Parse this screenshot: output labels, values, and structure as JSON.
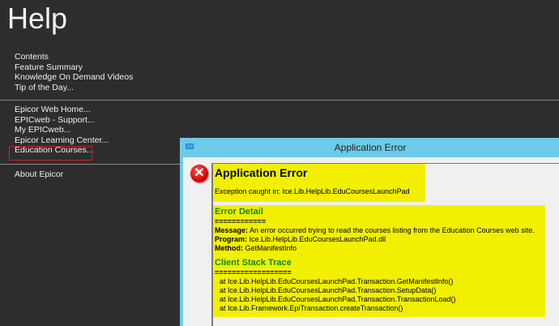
{
  "title": "Help",
  "menu_group1": [
    "Contents",
    "Feature Summary",
    "Knowledge On Demand Videos",
    "Tip of the Day..."
  ],
  "menu_group2": [
    "Epicor Web Home...",
    "EPICweb - Support...",
    "My EPICweb...",
    "Epicor Learning Center...",
    "Education Courses..."
  ],
  "menu_group3": [
    "About Epicor"
  ],
  "dialog": {
    "title": "Application Error",
    "heading": "Application Error",
    "exception": "Exception caught in: Ice.Lib.HelpLib.EduCoursesLaunchPad",
    "detail_heading": "Error Detail",
    "detail_rule": "============",
    "message_label": "Message:",
    "message": " An error occurred trying to read the courses listing from the Education Courses web site.",
    "program_label": "Program:",
    "program": " Ice.Lib.HelpLib.EduCoursesLaunchPad.dll",
    "method_label": "Method:",
    "method": " GetManifestInfo",
    "stack_heading": "Client Stack Trace",
    "stack_rule": "==================",
    "stack": [
      "at Ice.Lib.HelpLib.EduCoursesLaunchPad.Transaction.GetManifestInfo()",
      "at Ice.Lib.HelpLib.EduCoursesLaunchPad.Transaction.SetupData()",
      "at Ice.Lib.HelpLib.EduCoursesLaunchPad.Transaction.TransactionLoad()",
      "at Ice.Lib.Framework.EpiTransaction.createTransaction()"
    ]
  }
}
